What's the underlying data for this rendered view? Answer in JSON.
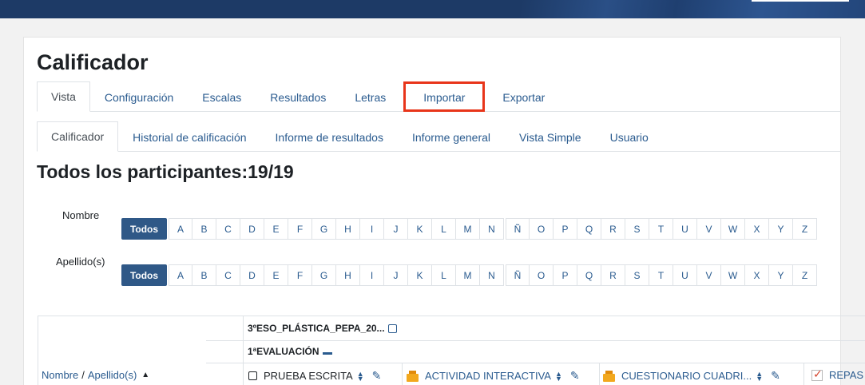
{
  "page": {
    "title": "Calificador",
    "subtitle": "Todos los participantes:19/19"
  },
  "tabs_primary": [
    {
      "label": "Vista",
      "active": true
    },
    {
      "label": "Configuración"
    },
    {
      "label": "Escalas"
    },
    {
      "label": "Resultados"
    },
    {
      "label": "Letras"
    },
    {
      "label": "Importar",
      "highlighted": true
    },
    {
      "label": "Exportar"
    }
  ],
  "tabs_secondary": [
    {
      "label": "Calificador",
      "active": true
    },
    {
      "label": "Historial de calificación"
    },
    {
      "label": "Informe de resultados"
    },
    {
      "label": "Informe general"
    },
    {
      "label": "Vista Simple"
    },
    {
      "label": "Usuario"
    }
  ],
  "filters": {
    "first_name_label": "Nombre",
    "last_name_label": "Apellido(s)",
    "all_label": "Todos",
    "letters": [
      "A",
      "B",
      "C",
      "D",
      "E",
      "F",
      "G",
      "H",
      "I",
      "J",
      "K",
      "L",
      "M",
      "N",
      "Ñ",
      "O",
      "P",
      "Q",
      "R",
      "S",
      "T",
      "U",
      "V",
      "W",
      "X",
      "Y",
      "Z"
    ]
  },
  "grader": {
    "course_category": "3ºESO_PLÁSTICA_PEPA_20...",
    "evaluation_category": "1ªEVALUACIÓN",
    "name_header": {
      "first": "Nombre",
      "separator": "/",
      "last": "Apellido(s)"
    },
    "items": [
      {
        "name": "PRUEBA ESCRITA",
        "icon": "checkbox-icon",
        "link": false
      },
      {
        "name": "ACTIVIDAD INTERACTIVA",
        "icon": "activity-icon",
        "link": true
      },
      {
        "name": "CUESTIONARIO CUADRI...",
        "icon": "activity-icon",
        "link": true
      },
      {
        "name": "REPAS",
        "icon": "assignment-icon",
        "link": true
      }
    ]
  },
  "colors": {
    "accent": "#2f5887",
    "link": "#2a5b8f",
    "highlight": "#e8351a",
    "topbar": "#1d3a66"
  }
}
